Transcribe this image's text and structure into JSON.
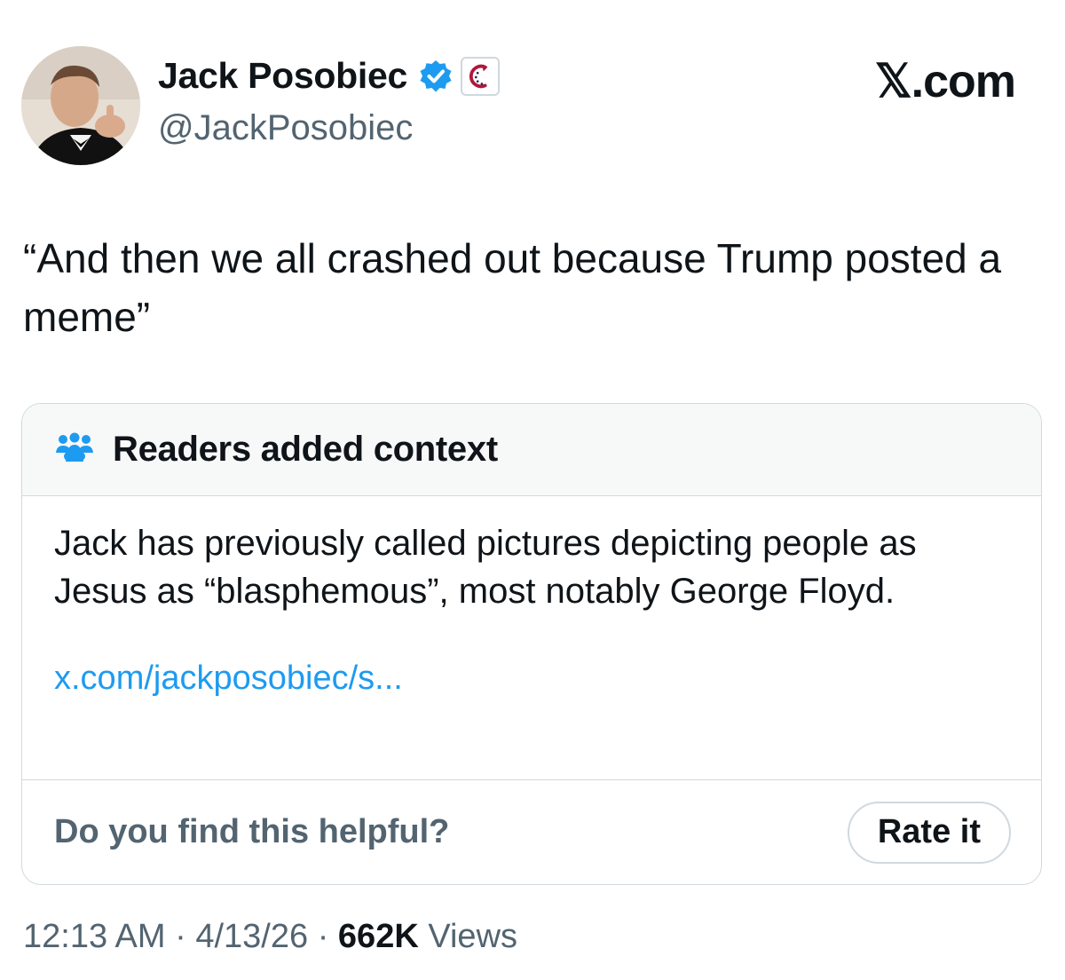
{
  "author": {
    "display_name": "Jack Posobiec",
    "handle": "@JackPosobiec",
    "verified_icon": "verified-badge-icon",
    "affiliation_icon": "affiliate-badge-icon"
  },
  "brand": "𝕏.com",
  "tweet": {
    "text": "“And then we all crashed out because Trump posted a meme”"
  },
  "community_note": {
    "icon": "people-icon",
    "title": "Readers added context",
    "body": "Jack has previously called pictures depicting people as Jesus as “blasphemous”, most notably George Floyd.",
    "link": "x.com/jackposobiec/s...",
    "question": "Do you find this helpful?",
    "rate_label": "Rate it"
  },
  "meta": {
    "time": "12:13 AM",
    "separator": "·",
    "date": "4/13/26",
    "views_count": "662K",
    "views_label": "Views"
  },
  "colors": {
    "link": "#1d9bf0",
    "verified": "#1d9bf0",
    "secondary_text": "#536471",
    "border": "#cfd9de"
  }
}
